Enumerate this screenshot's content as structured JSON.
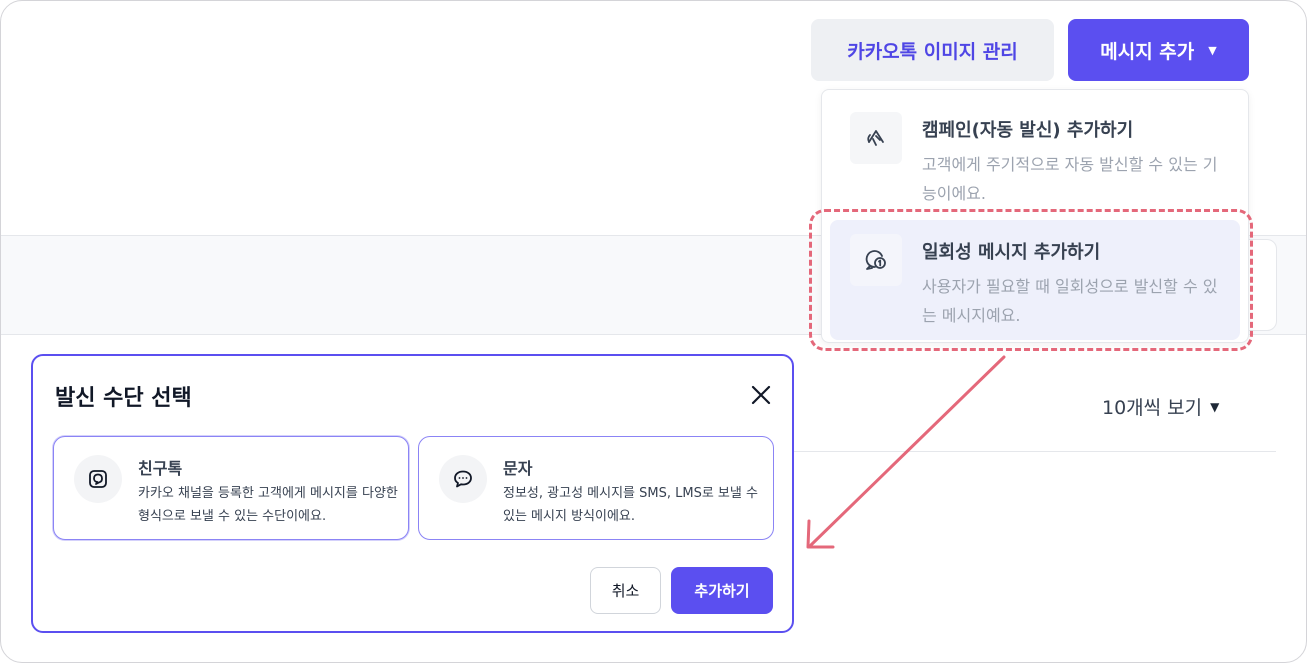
{
  "header": {
    "kakao_image_button": "카카오톡 이미지 관리",
    "add_message_button": "메시지 추가"
  },
  "dropdown": {
    "items": [
      {
        "title": "캠페인(자동 발신) 추가하기",
        "description": "고객에게 주기적으로 자동 발신할 수 있는 기능이에요.",
        "icon": "megaphone-icon"
      },
      {
        "title": "일회성 메시지 추가하기",
        "description": "사용자가 필요할 때 일회성으로 발신할 수 있는 메시지예요.",
        "icon": "one-time-message-icon"
      }
    ]
  },
  "list": {
    "per_page": "10개씩 보기"
  },
  "modal": {
    "title": "발신 수단 선택",
    "options": [
      {
        "title": "친구톡",
        "description": "카카오 채널을 등록한 고객에게 메시지를 다양한 형식으로 보낼 수 있는 수단이에요.",
        "icon": "kakao-chat-icon"
      },
      {
        "title": "문자",
        "description": "정보성, 광고성 메시지를 SMS, LMS로 보낼 수 있는 메시지 방식이에요.",
        "icon": "speech-bubble-icon"
      }
    ],
    "cancel_button": "취소",
    "confirm_button": "추가하기"
  },
  "colors": {
    "accent": "#5b4ff0",
    "highlight": "#e4687a",
    "selected_item_bg": "#eef0fb"
  }
}
